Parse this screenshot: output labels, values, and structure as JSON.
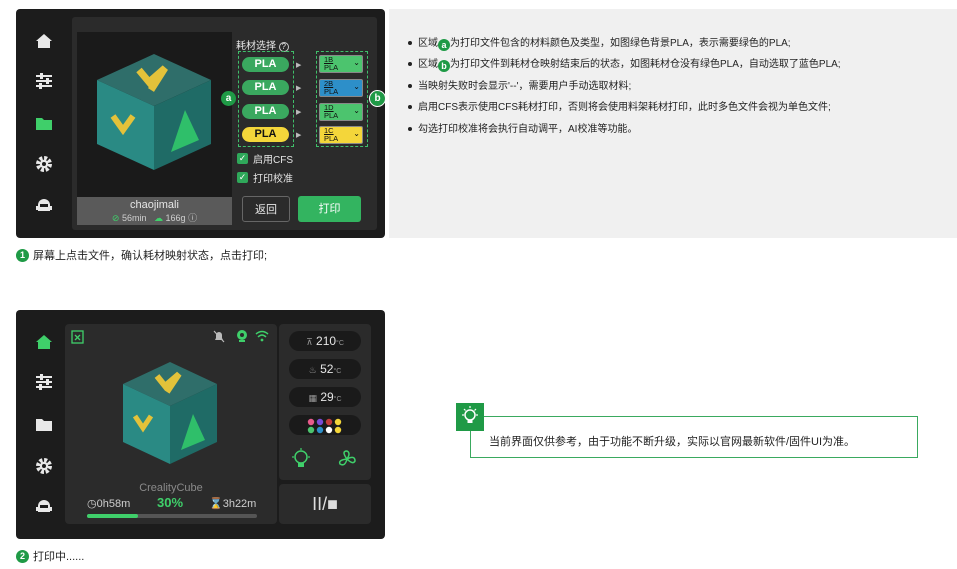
{
  "screen1": {
    "model_name": "chaojimali",
    "time": "56min",
    "weight": "166g",
    "material_section_title": "耗材选择",
    "help_icon": "question-icon",
    "file_materials": [
      {
        "label": "PLA",
        "color": "#3aa85f"
      },
      {
        "label": "PLA",
        "color": "#3aa85f"
      },
      {
        "label": "PLA",
        "color": "#3aa85f"
      },
      {
        "label": "PLA",
        "color": "#f4d63a"
      }
    ],
    "slots": [
      {
        "id": "1B",
        "type": "PLA",
        "color": "#4cc46e"
      },
      {
        "id": "2B",
        "type": "PLA",
        "color": "#2d8fc9"
      },
      {
        "id": "1D",
        "type": "PLA",
        "color": "#4cc46e"
      },
      {
        "id": "1C",
        "type": "PLA",
        "color": "#f4d63a"
      }
    ],
    "badge_a": "a",
    "badge_b": "b",
    "enable_cfs_label": "启用CFS",
    "calibration_label": "打印校准",
    "back_label": "返回",
    "print_label": "打印"
  },
  "notes": [
    {
      "pre": "区域",
      "badge": "a",
      "text": "为打印文件包含的材料颜色及类型，如图绿色背景PLA，表示需要绿色的PLA;"
    },
    {
      "pre": "区域",
      "badge": "b",
      "text": "为打印文件到耗材仓映射结束后的状态，如图耗材仓没有绿色PLA，自动选取了蓝色PLA;"
    },
    {
      "pre": "",
      "badge": "",
      "text": "当映射失败时会显示'--'，需要用户手动选取材料;"
    },
    {
      "pre": "",
      "badge": "",
      "text": "启用CFS表示使用CFS耗材打印，否则将会使用料架耗材打印，此时多色文件会视为单色文件;"
    },
    {
      "pre": "",
      "badge": "",
      "text": "勾选打印校准将会执行自动调平，AI校准等功能。"
    }
  ],
  "step1": {
    "num": "1",
    "text": "屏幕上点击文件，确认耗材映射状态，点击打印;"
  },
  "step2": {
    "num": "2",
    "text": "打印中......"
  },
  "screen2": {
    "model_name": "CrealityCube",
    "elapsed": "0h58m",
    "progress_text": "30%",
    "progress_value": 0.3,
    "remaining": "3h22m",
    "nozzle_temp": "210",
    "bed_temp": "52",
    "chamber_temp": "29",
    "temp_unit": "°C",
    "filament_colors": [
      "#e85b8c",
      "#7a4bd6",
      "#c23b3b",
      "#f4d63a",
      "#4cc46e",
      "#2d8fc9",
      "#ffffff",
      "#f4d63a"
    ],
    "pause_stop": "II/■"
  },
  "info": {
    "text": "当前界面仅供参考，由于功能不断升级，实际以官网最新软件/固件UI为准。",
    "icon": "lightbulb-icon"
  },
  "colors": {
    "accent": "#1f9a46",
    "screen_bg": "#1c1c1c",
    "panel_bg": "#2b2b2b"
  }
}
